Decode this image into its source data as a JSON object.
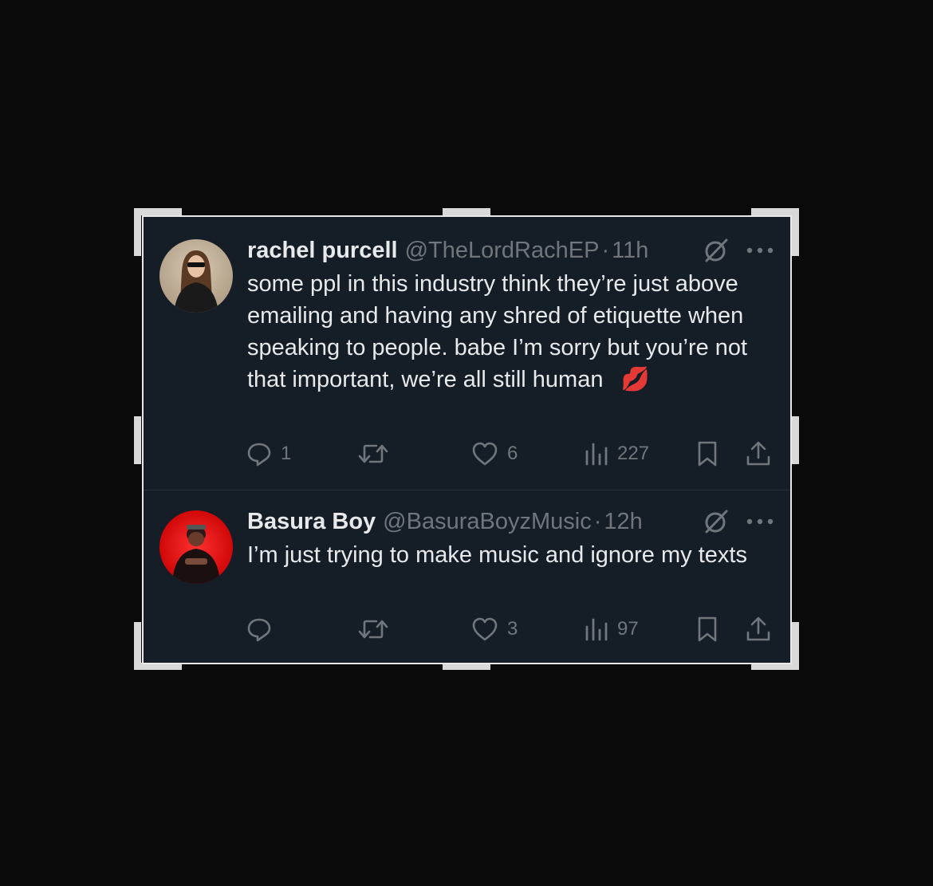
{
  "tweets": [
    {
      "name": "rachel purcell",
      "handle": "@TheLordRachEP",
      "separator": "·",
      "time": "11h",
      "text": "some ppl in this industry think they’re just above emailing and having any shred of etiquette when speaking to people. babe I’m sorry but you’re not that important, we’re all still human",
      "emoji": "💋",
      "replies": "1",
      "retweets": "",
      "likes": "6",
      "views": "227"
    },
    {
      "name": "Basura Boy",
      "handle": "@BasuraBoyzMusic",
      "separator": "·",
      "time": "12h",
      "text": "I’m just trying to make music and ignore my texts",
      "replies": "",
      "retweets": "",
      "likes": "3",
      "views": "97"
    }
  ],
  "icons": {
    "reply": "reply-icon",
    "retweet": "retweet-icon",
    "like": "like-icon",
    "views": "views-icon",
    "bookmark": "bookmark-icon",
    "share": "share-icon",
    "grok": "grok-icon",
    "more": "more-icon"
  },
  "colors": {
    "card_bg": "#151d27",
    "text_primary": "#e7e9ea",
    "text_secondary": "#71767b",
    "page_bg": "#0a0a0a"
  }
}
